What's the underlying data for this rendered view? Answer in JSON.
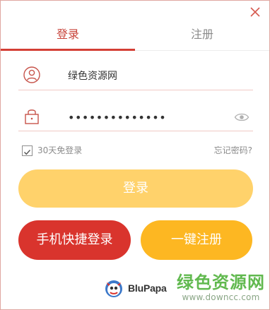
{
  "dialog": {
    "close_icon": "close-icon"
  },
  "tabs": {
    "login_label": "登录",
    "register_label": "注册"
  },
  "username": {
    "icon": "user-icon",
    "value": "绿色资源网"
  },
  "password": {
    "icon": "lock-icon",
    "masked_value": "••••••••••••••",
    "show_icon": "eye-icon"
  },
  "remember": {
    "checked": true,
    "label": "30天免登录"
  },
  "forgot_label": "忘记密码?",
  "buttons": {
    "login": "登录",
    "phone_login": "手机快捷登录",
    "one_click_register": "一键注册"
  },
  "brand": {
    "name": "BluPapa"
  },
  "watermark": {
    "title": "绿色资源网",
    "url": "www.downcc.com"
  },
  "colors": {
    "accent": "#d43f35",
    "tab_active_text": "#c8433a",
    "login_button": "#ffd26b",
    "phone_button": "#d9342d",
    "register_button": "#fdb722",
    "watermark_green": "#61b94f"
  }
}
